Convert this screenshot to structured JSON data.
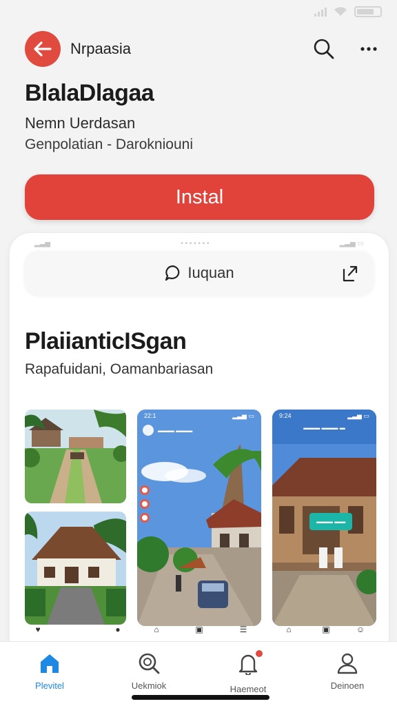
{
  "colors": {
    "accent": "#e1433a",
    "active_nav": "#1e88e5",
    "background": "#f3f3f3"
  },
  "top_bar": {
    "back_icon": "arrow-left-icon",
    "title": "Nrpaasia",
    "search_icon": "search-icon",
    "more_icon": "more-horizontal-icon"
  },
  "app": {
    "name": "BlalaDlagaa",
    "developer": "Nemn Uerdasan",
    "category": "Genpolatian - Darokniouni",
    "install_label": "Instal"
  },
  "preview": {
    "search_label": "Iuquan",
    "search_icon": "chat-bubble-icon",
    "share_icon": "share-icon",
    "title": "PlaiianticISgan",
    "subtitle": "Rapafuidani, Oamanbariasan"
  },
  "bottom_nav": {
    "items": [
      {
        "label": "Plevitel",
        "icon": "home-icon",
        "active": true
      },
      {
        "label": "Uekmiok",
        "icon": "search-icon",
        "active": false
      },
      {
        "label": "Haemeot",
        "icon": "bell-icon",
        "active": false
      },
      {
        "label": "Deinoen",
        "icon": "person-icon",
        "active": false
      }
    ]
  }
}
